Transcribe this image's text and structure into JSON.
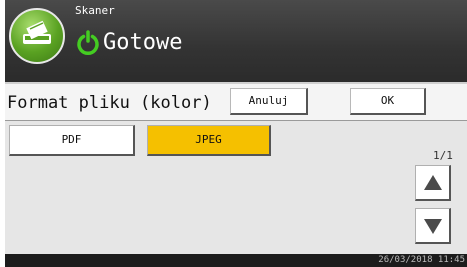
{
  "header": {
    "app_name": "Skaner",
    "app_icon": "scanner-icon",
    "status_icon": "power-ready-icon",
    "status_text": "Gotowe"
  },
  "dialog": {
    "title": "Format pliku (kolor)",
    "cancel_label": "Anuluj",
    "ok_label": "OK"
  },
  "options": [
    {
      "label": "PDF",
      "selected": false
    },
    {
      "label": "JPEG",
      "selected": true
    }
  ],
  "pagination": {
    "indicator": "1/1",
    "up_icon": "arrow-up-icon",
    "down_icon": "arrow-down-icon"
  },
  "footer": {
    "datetime": "26/03/2018 11:45"
  },
  "colors": {
    "header_bg": "#333333",
    "selected_option": "#f5c000",
    "status_green": "#44cc22",
    "app_icon_green": "#5aa222"
  }
}
